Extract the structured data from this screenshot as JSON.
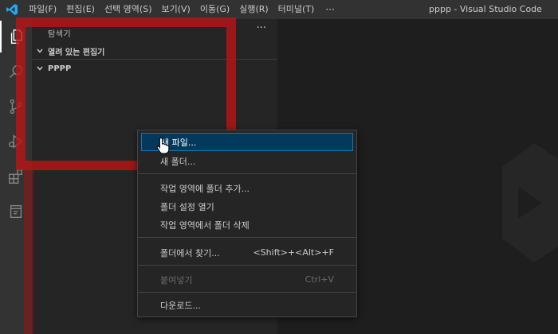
{
  "menu": {
    "items": [
      "파일(F)",
      "편집(E)",
      "선택 영역(S)",
      "보기(V)",
      "이동(G)",
      "실행(R)",
      "터미널(T)"
    ],
    "more": "···"
  },
  "window_title": "pppp - Visual Studio Code",
  "activity_icons": [
    "explorer-icon",
    "search-icon",
    "source-control-icon",
    "run-debug-icon",
    "extensions-icon",
    "remote-explorer-icon"
  ],
  "sidebar": {
    "title": "탐색기",
    "more": "···",
    "open_editors": "열려 있는 편집기",
    "folder": "PPPP"
  },
  "context_menu": {
    "new_file": "새 파일...",
    "new_folder": "새 폴더...",
    "add_folder": "작업 영역에 폴더 추가...",
    "open_folder_settings": "폴더 설정 열기",
    "remove_folder": "작업 영역에서 폴더 삭제",
    "find_in_folder": "폴더에서 찾기...",
    "find_in_folder_shortcut": "<Shift>+<Alt>+F",
    "paste": "붙여넣기",
    "paste_shortcut": "Ctrl+V",
    "download": "다운로드..."
  },
  "colors": {
    "titlebar": "#323233",
    "activitybar": "#333333",
    "sidebar": "#252526",
    "editor": "#1e1e1e",
    "selection": "#04395e",
    "vscode_blue": "#23a9f2",
    "annotation_red": "#be1414"
  }
}
